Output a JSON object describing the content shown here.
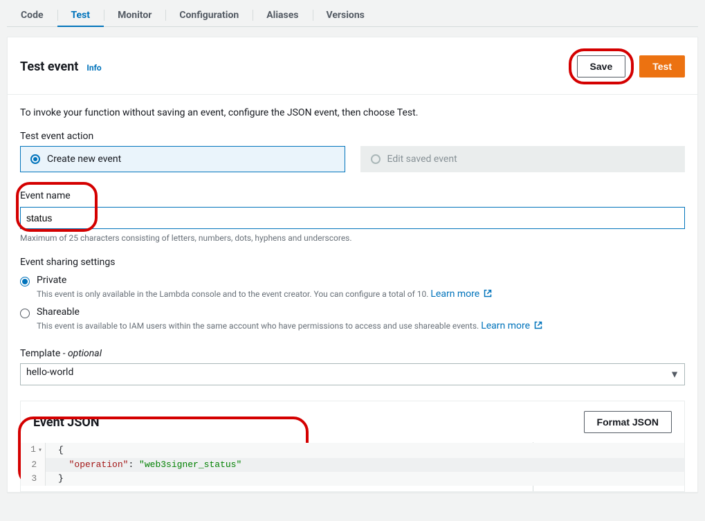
{
  "tabs": {
    "code": "Code",
    "test": "Test",
    "monitor": "Monitor",
    "configuration": "Configuration",
    "aliases": "Aliases",
    "versions": "Versions"
  },
  "panel": {
    "title": "Test event",
    "info": "Info",
    "save": "Save",
    "test": "Test",
    "intro": "To invoke your function without saving an event, configure the JSON event, then choose Test."
  },
  "action": {
    "label": "Test event action",
    "create": "Create new event",
    "edit": "Edit saved event"
  },
  "eventName": {
    "label": "Event name",
    "value": "status",
    "hint": "Maximum of 25 characters consisting of letters, numbers, dots, hyphens and underscores."
  },
  "sharing": {
    "label": "Event sharing settings",
    "private": "Private",
    "privateDesc": "This event is only available in the Lambda console and to the event creator. You can configure a total of 10.",
    "shareable": "Shareable",
    "shareableDesc": "This event is available to IAM users within the same account who have permissions to access and use shareable events.",
    "learn": "Learn more"
  },
  "template": {
    "label": "Template",
    "optional": "- optional",
    "selected": "hello-world"
  },
  "json": {
    "title": "Event JSON",
    "format": "Format JSON",
    "line1": "{",
    "line2_key": "\"operation\"",
    "line2_colon": ": ",
    "line2_val": "\"web3signer_status\"",
    "line3": "}"
  }
}
